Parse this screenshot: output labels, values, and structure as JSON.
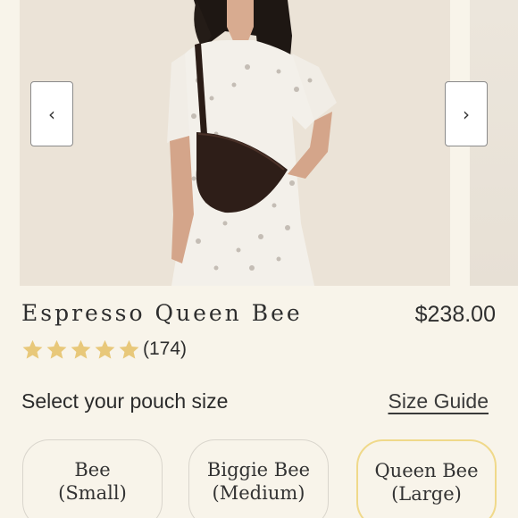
{
  "product": {
    "title": "Espresso Queen Bee",
    "price": "$238.00",
    "rating": 5,
    "review_count": "(174)"
  },
  "gallery": {
    "prev_icon": "‹",
    "next_icon": "›",
    "image_alt": "chevron-left-icon"
  },
  "size": {
    "label": "Select your pouch size",
    "guide_label": "Size Guide",
    "options": [
      {
        "name": "Bee",
        "size": "(Small)",
        "selected": false
      },
      {
        "name": "Biggie Bee",
        "size": "(Medium)",
        "selected": false
      },
      {
        "name": "Queen Bee",
        "size": "(Large)",
        "selected": true
      }
    ]
  },
  "colors": {
    "star": "#e8c87a",
    "selected_border": "#f0d98a",
    "background": "#f8f4ea"
  }
}
